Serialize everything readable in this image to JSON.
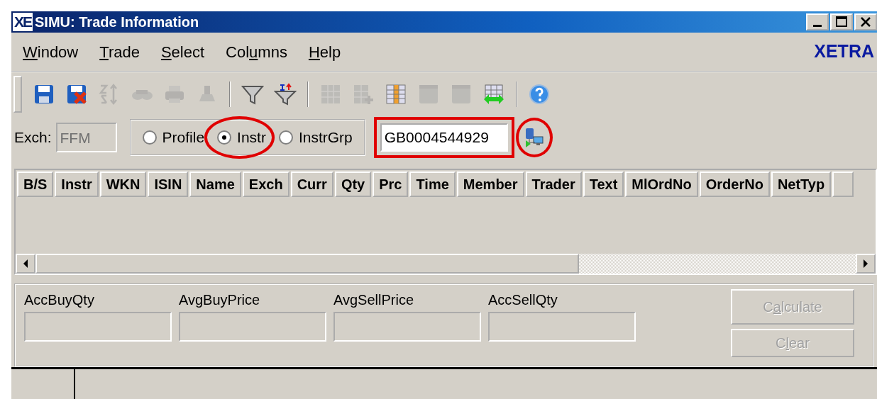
{
  "window": {
    "logo": "XE",
    "title": "SIMU: Trade Information",
    "brand": "XETRA"
  },
  "menu": [
    {
      "key": "W",
      "post": "indow"
    },
    {
      "key": "T",
      "post": "rade"
    },
    {
      "key": "S",
      "post": "elect"
    },
    {
      "pre": "Col",
      "key": "u",
      "post": "mns"
    },
    {
      "key": "H",
      "post": "elp"
    }
  ],
  "toolbar": [
    {
      "kind": "save",
      "disabled": false
    },
    {
      "kind": "save-delete",
      "disabled": false
    },
    {
      "kind": "sort",
      "disabled": true
    },
    {
      "kind": "binoculars",
      "disabled": true
    },
    {
      "kind": "printer",
      "disabled": true
    },
    {
      "kind": "stamp",
      "disabled": true
    },
    {
      "kind": "separator"
    },
    {
      "kind": "funnel",
      "disabled": false
    },
    {
      "kind": "funnel-sort",
      "disabled": false
    },
    {
      "kind": "separator"
    },
    {
      "kind": "grid",
      "disabled": true
    },
    {
      "kind": "grid-plus",
      "disabled": true
    },
    {
      "kind": "columns",
      "disabled": false
    },
    {
      "kind": "panel",
      "disabled": true
    },
    {
      "kind": "panel",
      "disabled": true
    },
    {
      "kind": "grid-arrows",
      "disabled": false
    },
    {
      "kind": "separator"
    },
    {
      "kind": "help",
      "disabled": false
    }
  ],
  "filter": {
    "exch_label": "Exch:",
    "exch_value": "FFM",
    "radios": [
      {
        "label": "Profile",
        "selected": false,
        "circled": false
      },
      {
        "label": "Instr",
        "selected": true,
        "circled": true
      },
      {
        "label": "InstrGrp",
        "selected": false,
        "circled": false
      }
    ],
    "instrument": {
      "value": "GB0004544929",
      "highlighted": true
    },
    "lookup": {
      "circled": true
    }
  },
  "table": {
    "columns": [
      "B/S",
      "Instr",
      "WKN",
      "ISIN",
      "Name",
      "Exch",
      "Curr",
      "Qty",
      "Prc",
      "Time",
      "Member",
      "Trader",
      "Text",
      "MlOrdNo",
      "OrderNo",
      "NetTyp"
    ]
  },
  "summary": {
    "fields": [
      {
        "label": "AccBuyQty"
      },
      {
        "label": "AvgBuyPrice"
      },
      {
        "label": "AvgSellPrice"
      },
      {
        "label": "AccSellQty"
      }
    ],
    "buttons": [
      {
        "pre": "C",
        "key": "a",
        "post": "lculate",
        "disabled": true
      },
      {
        "pre": "C",
        "key": "l",
        "post": "ear",
        "disabled": true
      }
    ]
  }
}
